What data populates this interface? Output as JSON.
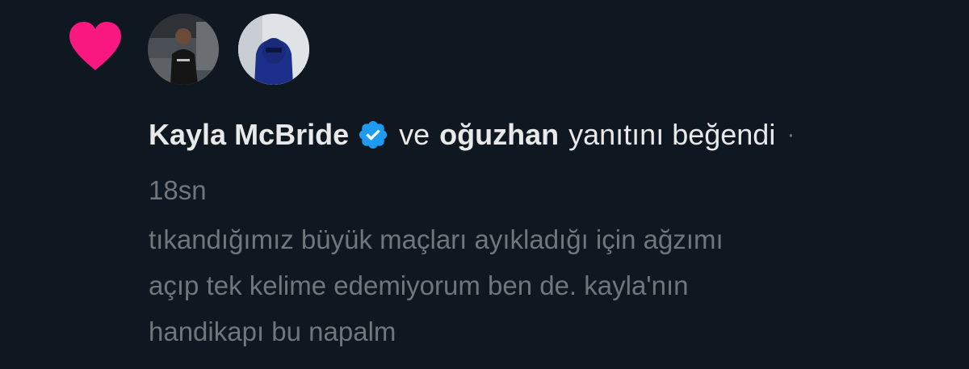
{
  "notification": {
    "icon": "heart-icon",
    "accent_color": "#f91880",
    "avatars": [
      {
        "name": "avatar-kayla-mcbride",
        "icon": "person-photo-avatar"
      },
      {
        "name": "avatar-oguzhan",
        "icon": "person-photo-avatar"
      }
    ],
    "user1": "Kayla McBride",
    "verified_icon": "verified-badge-icon",
    "verified_color": "#1d9bf0",
    "conjunction": "ve",
    "user2": "oğuzhan",
    "action": "yanıtını beğendi",
    "separator": "·",
    "timestamp": "18sn",
    "tweet_lines": [
      "tıkandığımız büyük maçları ayıkladığı için ağzımı",
      "açıp tek kelime edemiyorum ben de. kayla'nın",
      "handikapı bu napalm"
    ]
  }
}
